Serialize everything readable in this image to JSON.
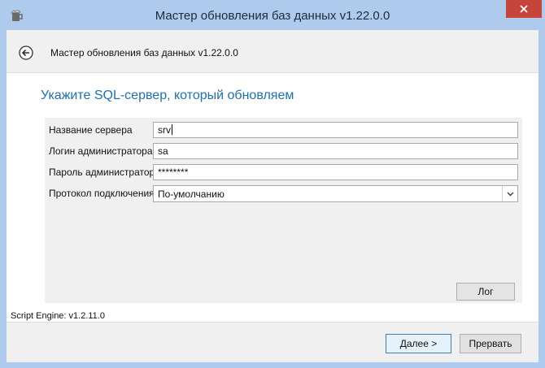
{
  "window": {
    "title": "Мастер обновления баз данных v1.22.0.0"
  },
  "header": {
    "title": "Мастер обновления баз данных v1.22.0.0"
  },
  "page": {
    "heading": "Укажите SQL-сервер, который обновляем"
  },
  "form": {
    "server_label": "Название сервера",
    "server_value": "srv",
    "login_label": "Логин администратора",
    "login_value": "sa",
    "password_label": "Пароль администратора",
    "password_value": "********",
    "protocol_label": "Протокол подключения",
    "protocol_value": "По-умолчанию"
  },
  "buttons": {
    "log": "Лог",
    "next_mnemonic": "Д",
    "next_rest": "алее >",
    "cancel": "Прервать"
  },
  "status": {
    "engine": "Script Engine: v1.2.11.0"
  },
  "colors": {
    "titlebar": "#aecbee",
    "close": "#c7443a",
    "heading": "#1e6fb4",
    "panel": "#f0f0f0"
  },
  "icons": {
    "app": "beer-mug-icon",
    "close": "close-icon",
    "back": "back-arrow-icon",
    "dropdown": "chevron-down-icon"
  }
}
